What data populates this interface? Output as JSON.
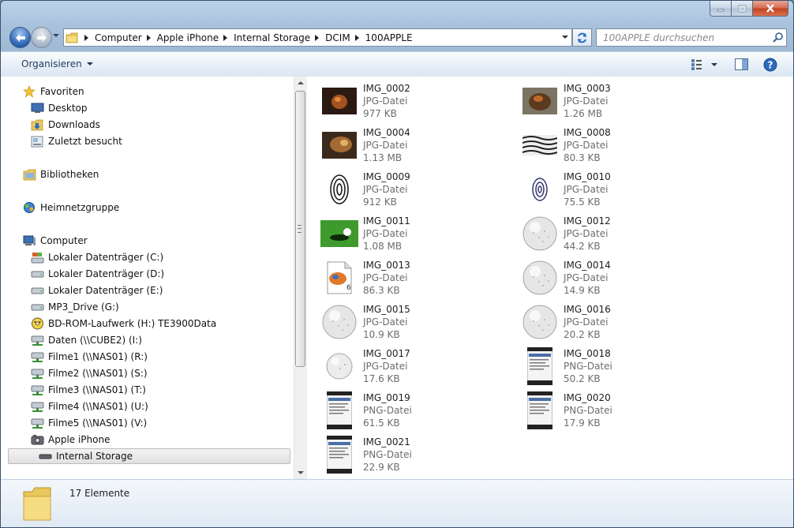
{
  "address": {
    "crumbs": [
      "Computer",
      "Apple iPhone",
      "Internal Storage",
      "DCIM",
      "100APPLE"
    ]
  },
  "search": {
    "placeholder": "100APPLE durchsuchen"
  },
  "toolbar": {
    "organize_label": "Organisieren"
  },
  "navigation": {
    "favorites": {
      "label": "Favoriten",
      "items": [
        "Desktop",
        "Downloads",
        "Zuletzt besucht"
      ]
    },
    "libraries": "Bibliotheken",
    "homegroup": "Heimnetzgruppe",
    "computer": {
      "label": "Computer",
      "items": [
        "Lokaler Datenträger (C:)",
        "Lokaler Datenträger (D:)",
        "Lokaler Datenträger (E:)",
        "MP3_Drive (G:)",
        "BD-ROM-Laufwerk (H:) TE3900Data",
        "Daten (\\\\CUBE2) (I:)",
        "Filme1 (\\\\NAS01) (R:)",
        "Filme2 (\\\\NAS01) (S:)",
        "Filme3 (\\\\NAS01) (T:)",
        "Filme4 (\\\\NAS01) (U:)",
        "Filme5 (\\\\NAS01) (V:)",
        "Apple iPhone"
      ]
    },
    "selected": "Internal Storage"
  },
  "files": [
    {
      "name": "IMG_0002",
      "type": "JPG-Datei",
      "size": "977 KB",
      "thumb": "dark-photo"
    },
    {
      "name": "IMG_0003",
      "type": "JPG-Datei",
      "size": "1.26 MB",
      "thumb": "bronze-photo"
    },
    {
      "name": "IMG_0004",
      "type": "JPG-Datei",
      "size": "1.13 MB",
      "thumb": "brown-photo"
    },
    {
      "name": "IMG_0008",
      "type": "JPG-Datei",
      "size": "80.3 KB",
      "thumb": "zebra-pattern"
    },
    {
      "name": "IMG_0009",
      "type": "JPG-Datei",
      "size": "912 KB",
      "thumb": "fingerprint-bw"
    },
    {
      "name": "IMG_0010",
      "type": "JPG-Datei",
      "size": "75.5 KB",
      "thumb": "fingerprint-blue"
    },
    {
      "name": "IMG_0011",
      "type": "JPG-Datei",
      "size": "1.08 MB",
      "thumb": "golf-green"
    },
    {
      "name": "IMG_0012",
      "type": "JPG-Datei",
      "size": "44.2 KB",
      "thumb": "golfball"
    },
    {
      "name": "IMG_0013",
      "type": "JPG-Datei",
      "size": "86.3 KB",
      "thumb": "generic-image"
    },
    {
      "name": "IMG_0014",
      "type": "JPG-Datei",
      "size": "14.9 KB",
      "thumb": "golfball"
    },
    {
      "name": "IMG_0015",
      "type": "JPG-Datei",
      "size": "10.9 KB",
      "thumb": "golfball"
    },
    {
      "name": "IMG_0016",
      "type": "JPG-Datei",
      "size": "20.2 KB",
      "thumb": "golfball"
    },
    {
      "name": "IMG_0017",
      "type": "JPG-Datei",
      "size": "17.6 KB",
      "thumb": "golfball-small"
    },
    {
      "name": "IMG_0018",
      "type": "PNG-Datei",
      "size": "50.2 KB",
      "thumb": "phone-screenshot"
    },
    {
      "name": "IMG_0019",
      "type": "PNG-Datei",
      "size": "61.5 KB",
      "thumb": "phone-screenshot"
    },
    {
      "name": "IMG_0020",
      "type": "PNG-Datei",
      "size": "17.9 KB",
      "thumb": "phone-screenshot"
    },
    {
      "name": "IMG_0021",
      "type": "PNG-Datei",
      "size": "22.9 KB",
      "thumb": "phone-screenshot"
    }
  ],
  "status": {
    "count": "17 Elemente"
  },
  "colors": {
    "accent": "#1e395b",
    "frame": "#a9c2dc",
    "folder": "#e9c75a"
  }
}
